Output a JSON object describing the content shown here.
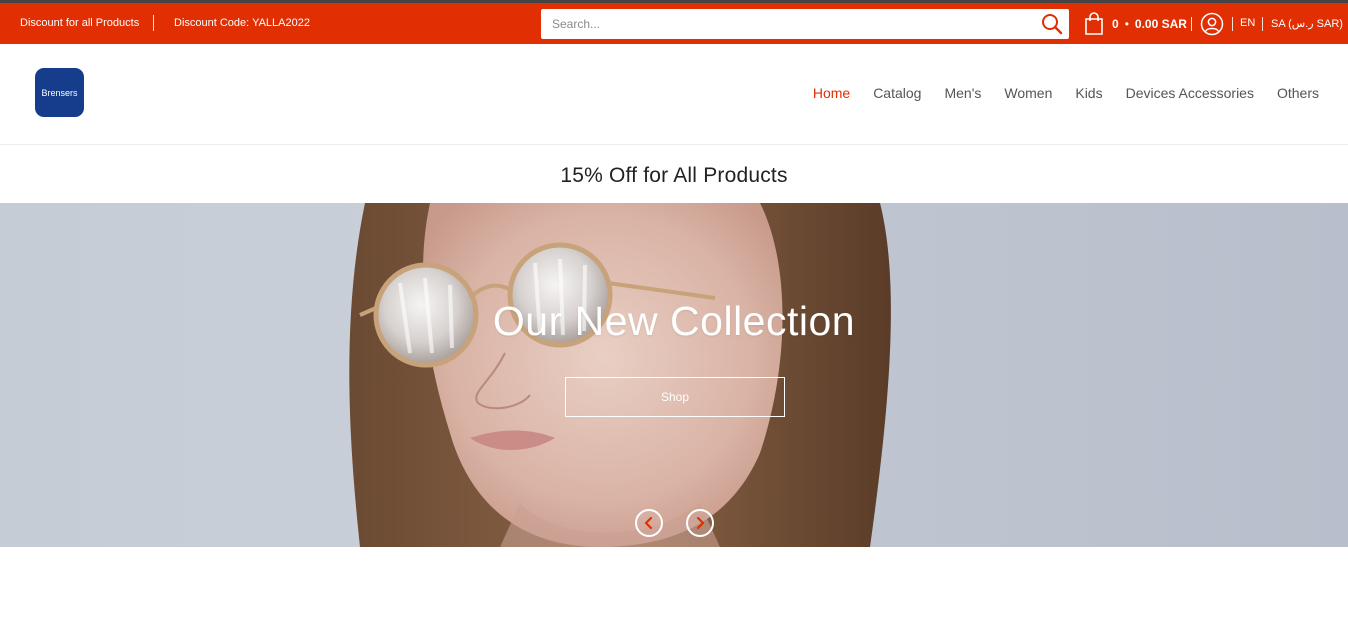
{
  "topbar": {
    "promo_left": "Discount for all Products",
    "promo_right": "Discount Code: YALLA2022",
    "search_placeholder": "Search...",
    "cart_count": "0",
    "cart_dot": "•",
    "cart_total": "0.00 SAR",
    "language": "EN",
    "region": "SA (ر.س SAR)",
    "colors": {
      "bar": "#e12e03",
      "strip": "#444444"
    }
  },
  "header": {
    "logo_text": "Brensers",
    "logo_color": "#163d8c",
    "nav": [
      {
        "label": "Home",
        "active": true
      },
      {
        "label": "Catalog"
      },
      {
        "label": "Men's"
      },
      {
        "label": "Women"
      },
      {
        "label": "Kids"
      },
      {
        "label": "Devices Accessories"
      },
      {
        "label": "Others"
      }
    ]
  },
  "announcement": "15% Off for All Products",
  "hero": {
    "title": "Our New Collection",
    "button_label": "Shop",
    "prev_icon": "chevron-left-icon",
    "next_icon": "chevron-right-icon",
    "arrow_color": "#e12e03"
  }
}
